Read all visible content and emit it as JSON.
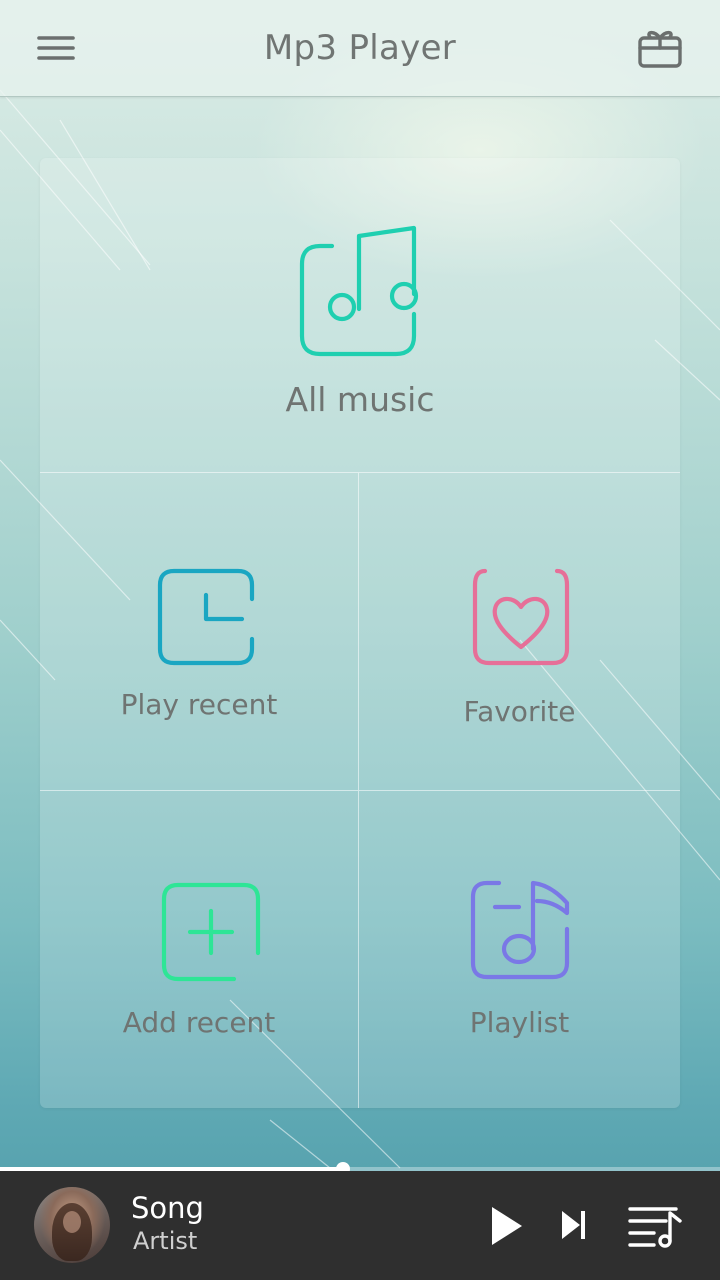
{
  "header": {
    "title": "Mp3 Player",
    "menu_icon": "hamburger-menu-icon",
    "gift_icon": "gift-icon"
  },
  "tiles": {
    "all_music": {
      "label": "All music",
      "icon": "music-note-icon",
      "color": "#1fcfb0"
    },
    "play_recent": {
      "label": "Play recent",
      "icon": "clock-icon",
      "color": "#1aa6c2"
    },
    "favorite": {
      "label": "Favorite",
      "icon": "heart-icon",
      "color": "#e66f98"
    },
    "add_recent": {
      "label": "Add recent",
      "icon": "plus-icon",
      "color": "#2ee596"
    },
    "playlist": {
      "label": "Playlist",
      "icon": "playlist-note-icon",
      "color": "#7a78e6"
    }
  },
  "player": {
    "song": "Song",
    "artist": "Artist",
    "progress": 0.476,
    "play_icon": "play-icon",
    "next_icon": "skip-next-icon",
    "queue_icon": "queue-music-icon"
  }
}
